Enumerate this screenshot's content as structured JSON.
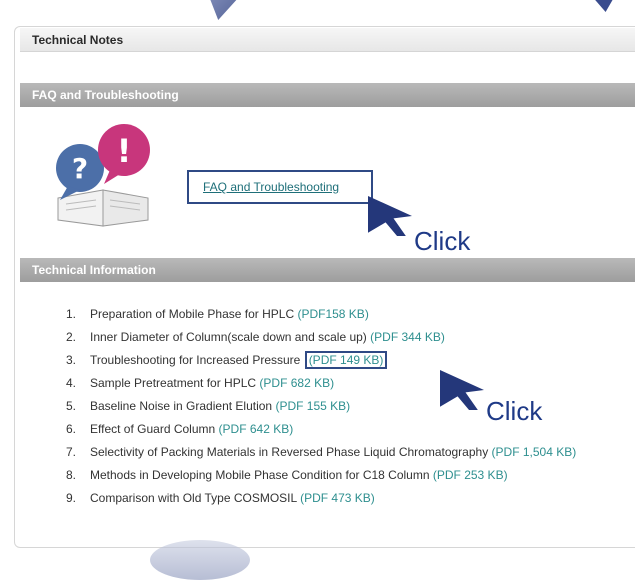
{
  "tech_notes": {
    "title": "Technical Notes"
  },
  "faq_section": {
    "header": "FAQ and Troubleshooting",
    "link_label": "FAQ and Troubleshooting",
    "click_label": "Click"
  },
  "tech_info": {
    "header": "Technical Information",
    "click_label": "Click",
    "items": [
      {
        "num": "1.",
        "title": "Preparation of Mobile Phase for HPLC",
        "size": "(PDF158 KB)"
      },
      {
        "num": "2.",
        "title": "Inner Diameter of Column(scale down and scale up)",
        "size": "(PDF 344 KB)"
      },
      {
        "num": "3.",
        "title": "Troubleshooting for Increased Pressure",
        "size": "(PDF 149 KB)"
      },
      {
        "num": "4.",
        "title": "Sample Pretreatment for HPLC",
        "size": "(PDF 682 KB)"
      },
      {
        "num": "5.",
        "title": "Baseline Noise in Gradient Elution",
        "size": "(PDF 155 KB)"
      },
      {
        "num": "6.",
        "title": "Effect of Guard Column",
        "size": "(PDF 642 KB)"
      },
      {
        "num": "7.",
        "title": "Selectivity of Packing Materials in Reversed Phase Liquid Chromatography",
        "size": "(PDF 1,504 KB)"
      },
      {
        "num": "8.",
        "title": "Methods in Developing Mobile Phase Condition for C18 Column",
        "size": "(PDF 253 KB)"
      },
      {
        "num": "9.",
        "title": "Comparison with Old Type COSMOSIL",
        "size": "(PDF 473 KB)"
      }
    ]
  },
  "colors": {
    "header_gray": "#a8a8a8",
    "link_teal": "#2e8f8f",
    "annotation_blue": "#24377a"
  }
}
